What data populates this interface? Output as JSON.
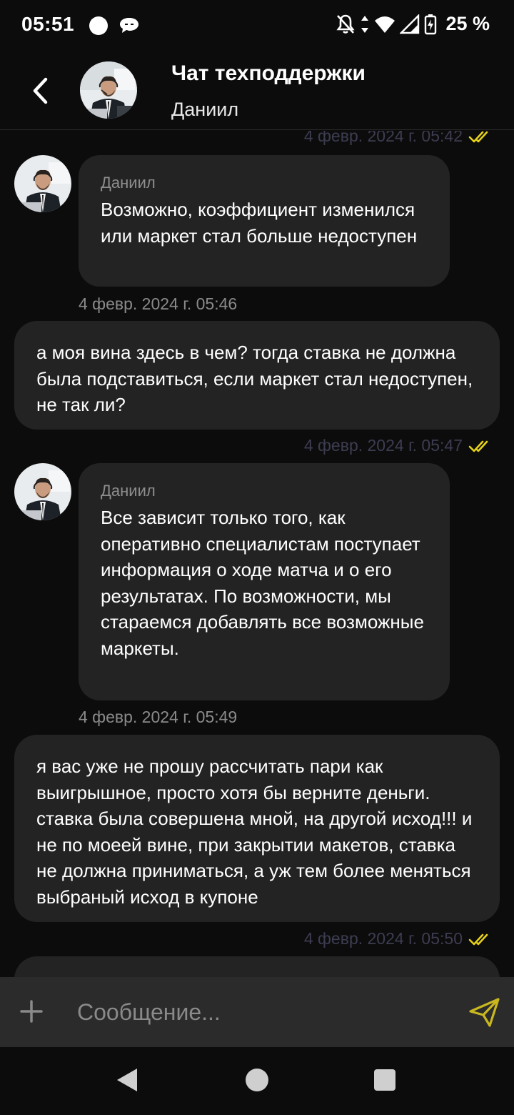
{
  "status_bar": {
    "time": "05:51",
    "battery_percent": "25 %",
    "icons": [
      "circle-notification-icon",
      "chat-bubble-icon",
      "bell-off-icon",
      "data-arrows-icon",
      "wifi-icon",
      "signal-icon",
      "battery-charging-icon"
    ]
  },
  "header": {
    "title": "Чат техподдержки",
    "subtitle": "Даниил",
    "back_icon": "chevron-left-icon",
    "avatar": "support-agent-avatar"
  },
  "messages": {
    "top_meta": {
      "timestamp": "4 февр. 2024 г. 05:42",
      "status": "read"
    },
    "items": [
      {
        "direction": "incoming",
        "sender": "Даниил",
        "text": "Возможно, коэффициент изменился или маркет стал больше недоступен",
        "timestamp": "4 февр. 2024 г. 05:46"
      },
      {
        "direction": "outgoing",
        "text": "а моя вина здесь в чем? тогда ставка не должна была подставиться, если маркет стал недоступен, не так ли?",
        "timestamp": "4 февр. 2024 г. 05:47",
        "status": "read"
      },
      {
        "direction": "incoming",
        "sender": "Даниил",
        "text": "Все зависит только того, как оперативно специалистам поступает информация о ходе матча и о его результатах. По возможности, мы стараемся добавлять все возможные маркеты.",
        "timestamp": "4 февр. 2024 г. 05:49"
      },
      {
        "direction": "outgoing",
        "text": "я вас уже не прошу рассчитать пари как выигрышное, просто хотя бы верните деньги. ставка была совершена мной, на другой исход!!! и не по моеей вине, при закрытии макетов, ставка не должна приниматься, а уж тем более меняться выбраный исход в купоне",
        "timestamp": "4 февр. 2024 г. 05:50",
        "status": "read"
      }
    ]
  },
  "composer": {
    "placeholder": "Сообщение...",
    "value": "",
    "attach_icon": "plus-icon",
    "send_icon": "send-icon"
  },
  "colors": {
    "background": "#0c0c0c",
    "bubble": "#232323",
    "accent_check": "#e6d11a",
    "meta_text_outgoing": "#3d3d52",
    "meta_text_incoming": "#8a8a8a",
    "composer_bg": "#2b2b2b"
  }
}
